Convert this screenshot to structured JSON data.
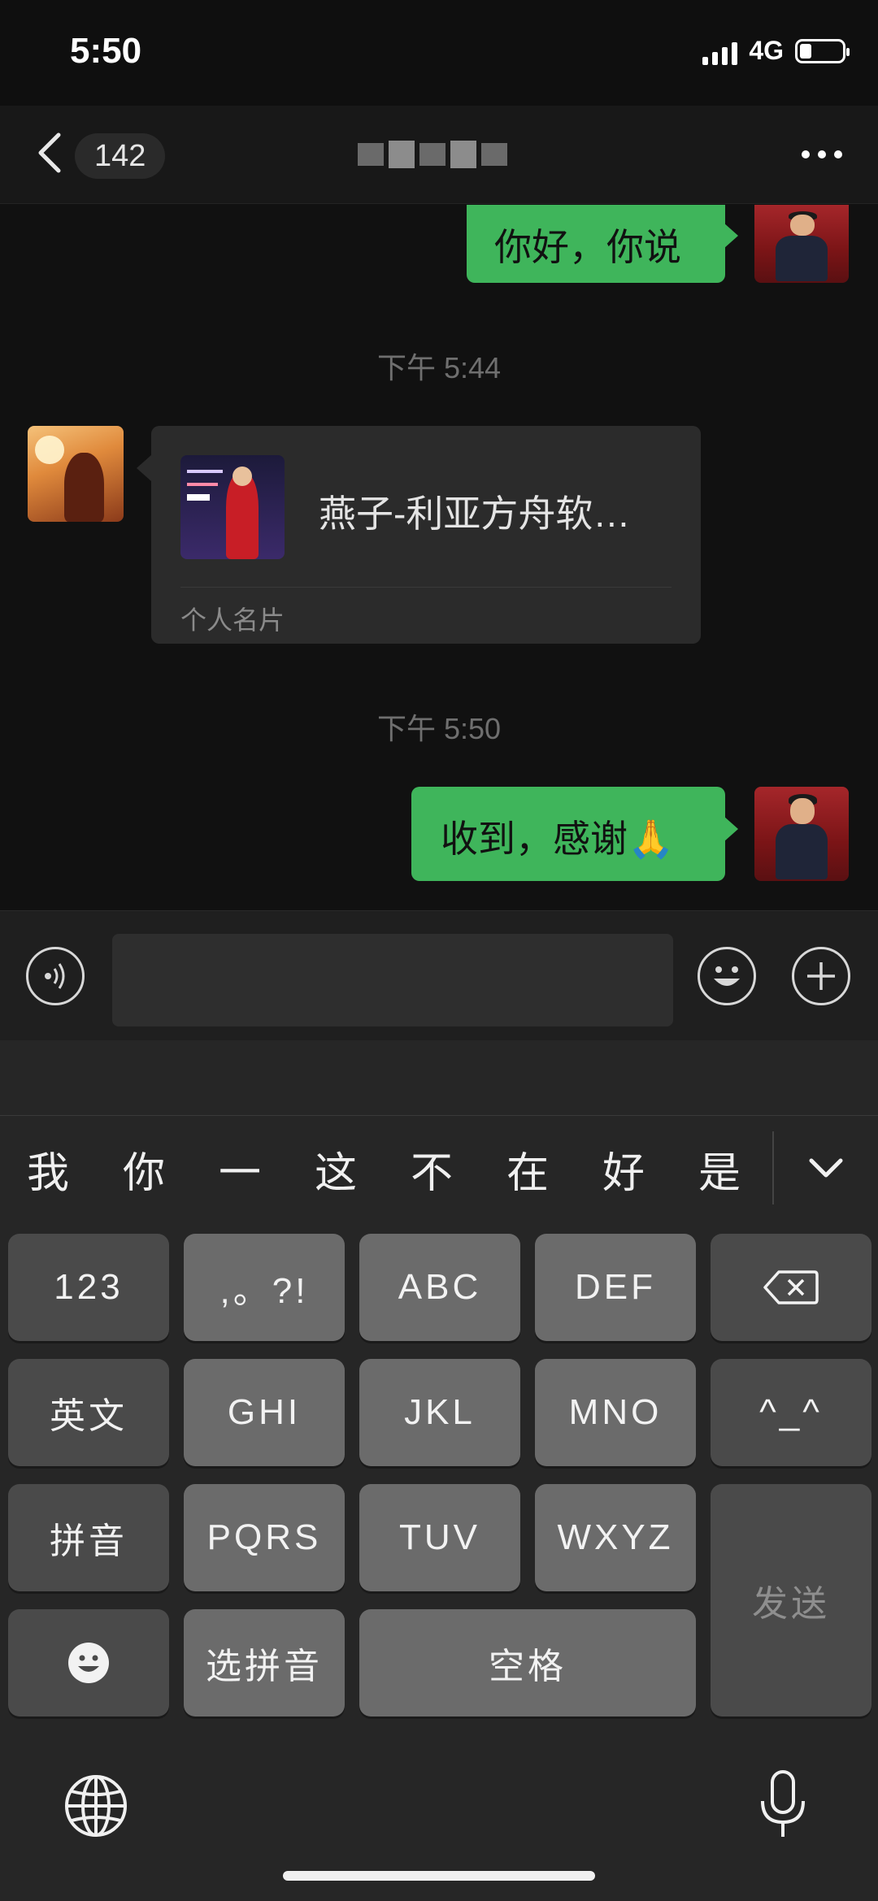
{
  "status_bar": {
    "time": "5:50",
    "network": "4G"
  },
  "nav": {
    "unread_count": "142"
  },
  "messages": {
    "outgoing_1": "你好，你说",
    "timestamp_1": "下午 5:44",
    "card_name": "燕子-利亚方舟软…",
    "card_type": "个人名片",
    "timestamp_2": "下午 5:50",
    "outgoing_2": "收到，感谢🙏"
  },
  "input": {
    "value": ""
  },
  "candidates": [
    "我",
    "你",
    "一",
    "这",
    "不",
    "在",
    "好",
    "是"
  ],
  "keyboard": {
    "k123": "123",
    "punct": ",。?!",
    "abc": "ABC",
    "def": "DEF",
    "english": "英文",
    "ghi": "GHI",
    "jkl": "JKL",
    "mno": "MNO",
    "emoticon": "^_^",
    "pinyin": "拼音",
    "pqrs": "PQRS",
    "tuv": "TUV",
    "wxyz": "WXYZ",
    "send": "发送",
    "select_pinyin": "选拼音",
    "space": "空格"
  },
  "colors": {
    "bubble_green": "#3fb55b",
    "background": "#111111",
    "keyboard_bg": "#262626"
  },
  "icons": [
    "back-icon",
    "more-icon",
    "voice-icon",
    "emoji-icon",
    "plus-icon",
    "collapse-icon",
    "backspace-icon",
    "smiley-icon",
    "globe-icon",
    "mic-icon"
  ]
}
